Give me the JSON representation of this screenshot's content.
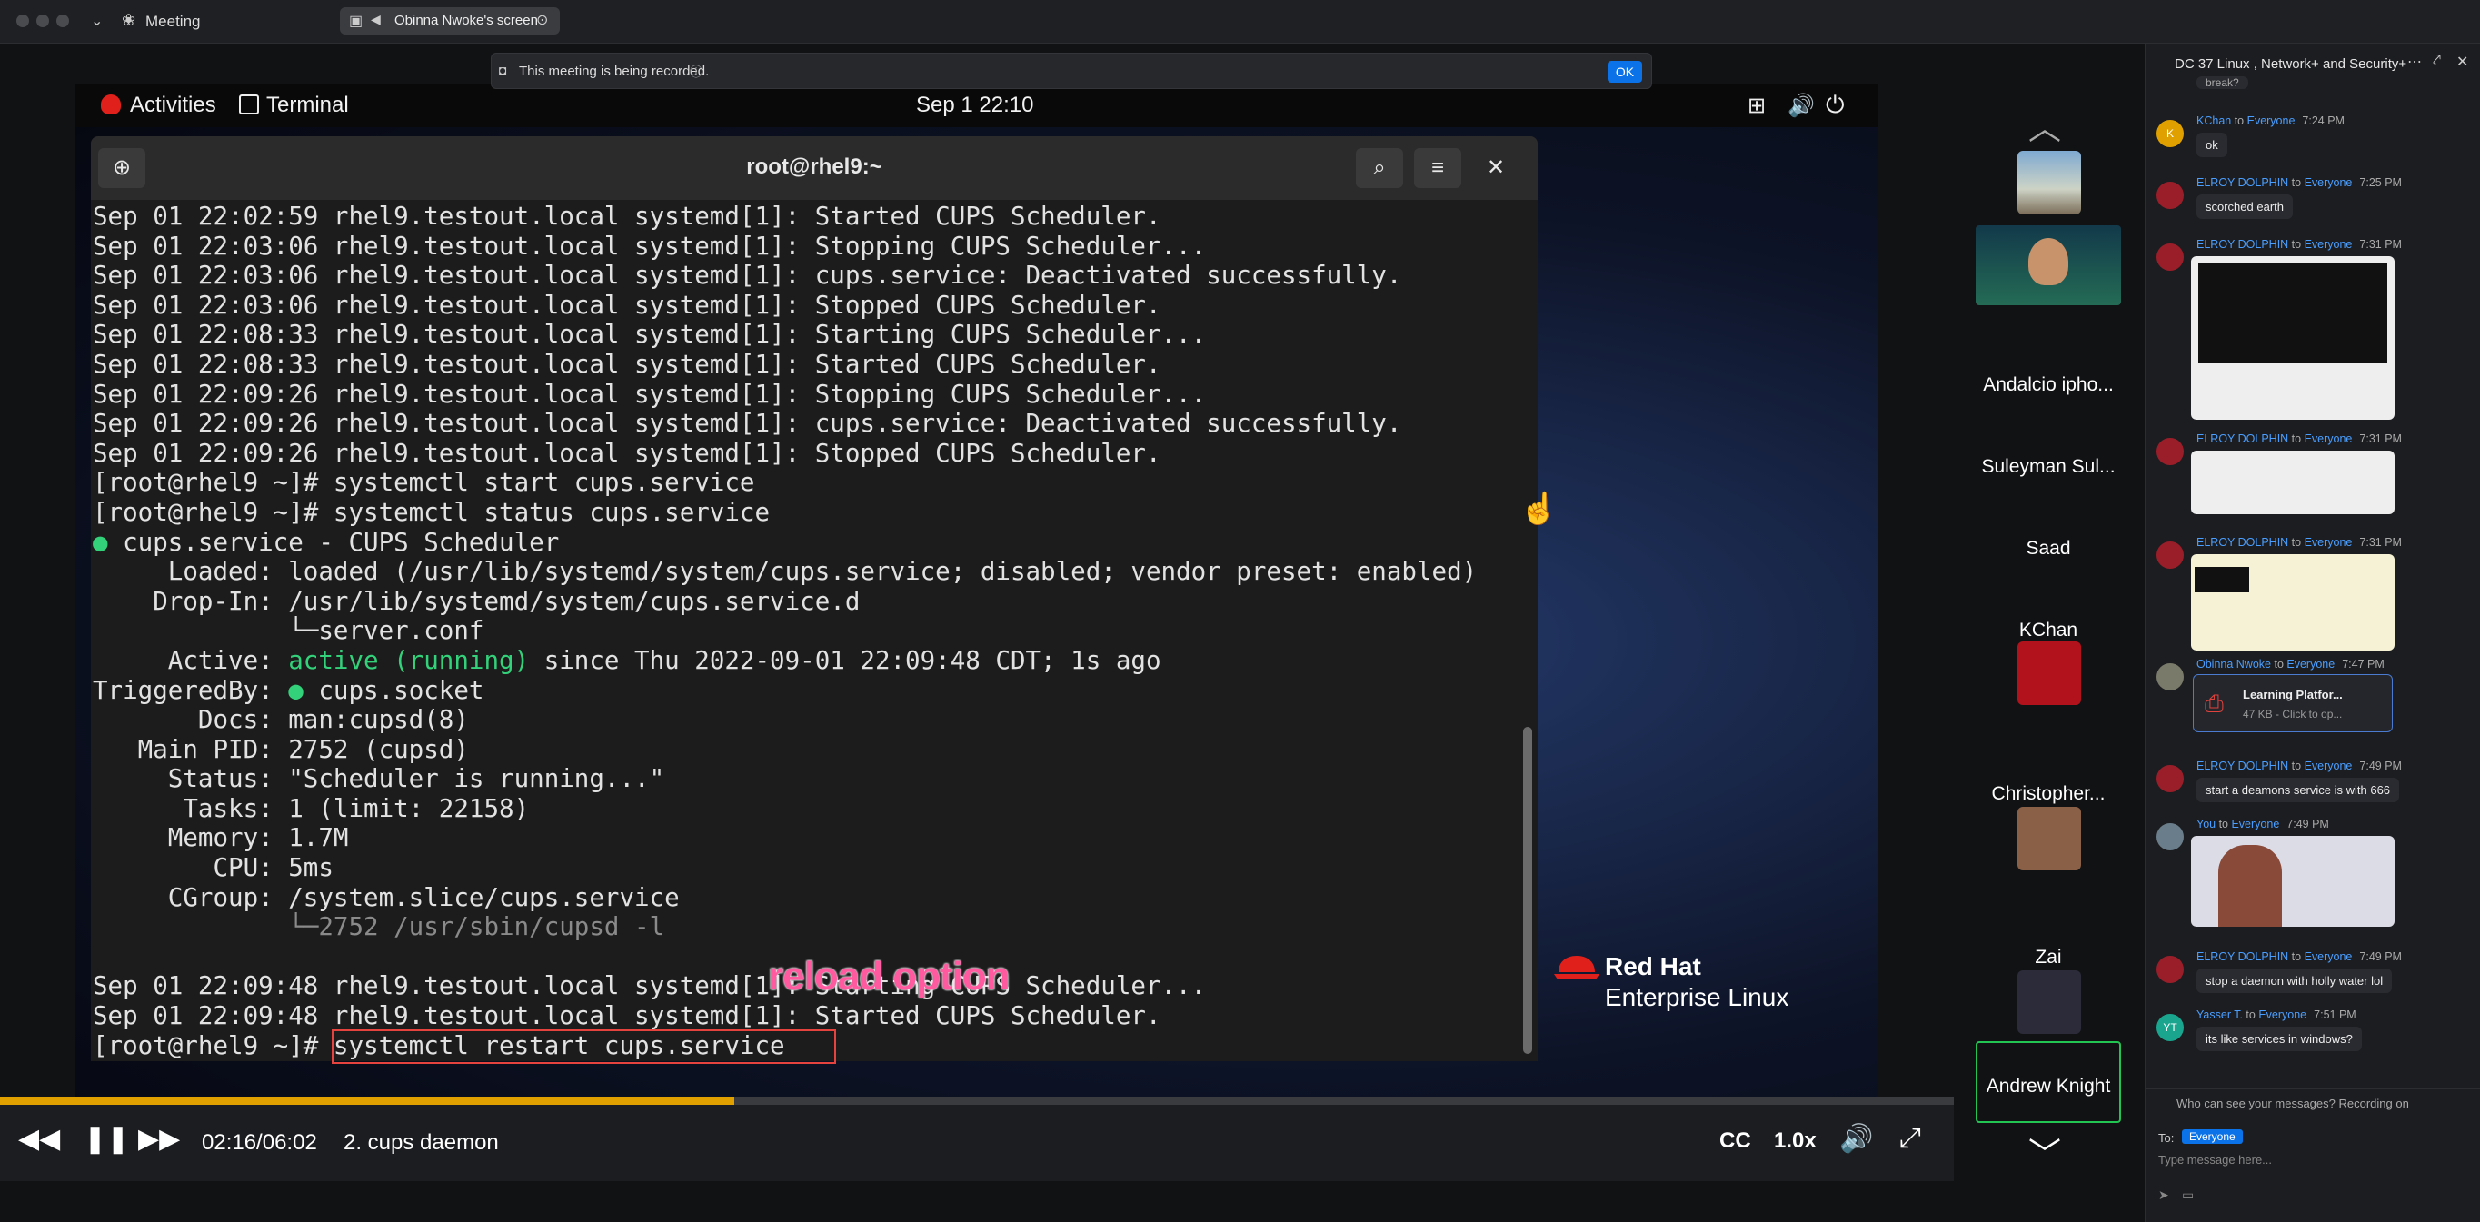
{
  "window": {
    "title": "Meeting",
    "share_pill": "Obinna Nwoke's screen"
  },
  "recording": {
    "text": "This meeting is being recorded.",
    "ok": "OK"
  },
  "desktop": {
    "activities": "Activities",
    "app": "Terminal",
    "clock": "Sep 1  22:10"
  },
  "terminal": {
    "title": "root@rhel9:~",
    "lines": [
      "Sep 01 22:02:59 rhel9.testout.local systemd[1]: Started CUPS Scheduler.",
      "Sep 01 22:03:06 rhel9.testout.local systemd[1]: Stopping CUPS Scheduler...",
      "Sep 01 22:03:06 rhel9.testout.local systemd[1]: cups.service: Deactivated successfully.",
      "Sep 01 22:03:06 rhel9.testout.local systemd[1]: Stopped CUPS Scheduler.",
      "Sep 01 22:08:33 rhel9.testout.local systemd[1]: Starting CUPS Scheduler...",
      "Sep 01 22:08:33 rhel9.testout.local systemd[1]: Started CUPS Scheduler.",
      "Sep 01 22:09:26 rhel9.testout.local systemd[1]: Stopping CUPS Scheduler...",
      "Sep 01 22:09:26 rhel9.testout.local systemd[1]: cups.service: Deactivated successfully.",
      "Sep 01 22:09:26 rhel9.testout.local systemd[1]: Stopped CUPS Scheduler.",
      "[root@rhel9 ~]# systemctl start cups.service",
      "[root@rhel9 ~]# systemctl status cups.service",
      "● cups.service - CUPS Scheduler",
      "     Loaded: loaded (/usr/lib/systemd/system/cups.service; disabled; vendor preset: enabled)",
      "    Drop-In: /usr/lib/systemd/system/cups.service.d",
      "             └─server.conf",
      "     Active: active (running) since Thu 2022-09-01 22:09:48 CDT; 1s ago",
      "TriggeredBy: ● cups.socket",
      "       Docs: man:cupsd(8)",
      "   Main PID: 2752 (cupsd)",
      "     Status: \"Scheduler is running...\"",
      "      Tasks: 1 (limit: 22158)",
      "     Memory: 1.7M",
      "        CPU: 5ms",
      "     CGroup: /system.slice/cups.service",
      "             └─2752 /usr/sbin/cupsd -l",
      "",
      "Sep 01 22:09:48 rhel9.testout.local systemd[1]: Starting CUPS Scheduler...",
      "Sep 01 22:09:48 rhel9.testout.local systemd[1]: Started CUPS Scheduler.",
      "[root@rhel9 ~]# systemctl restart cups.service"
    ]
  },
  "annotation": {
    "reload": "reload option"
  },
  "brand": {
    "line1": "Red Hat",
    "line2": "Enterprise Linux"
  },
  "player": {
    "time": "02:16/06:02",
    "chapter": "2. cups daemon",
    "cc": "CC",
    "speed": "1.0x",
    "progress": 0.376
  },
  "participants": [
    {
      "name": "Andalcio ipho...",
      "kind": "name"
    },
    {
      "name": "Suleyman Sul...",
      "kind": "name"
    },
    {
      "name": "Saad",
      "kind": "name"
    },
    {
      "name": "KChan",
      "kind": "name"
    },
    {
      "name": "Christopher...",
      "kind": "name"
    },
    {
      "name": "Zai",
      "kind": "name"
    },
    {
      "name": "Andrew Knight",
      "kind": "name"
    }
  ],
  "chat": {
    "title": "DC 37 Linux , Network+ and Security+",
    "to_label": "to",
    "everyone": "Everyone",
    "messages": [
      {
        "from": "KChan",
        "time": "7:24 PM",
        "text": "ok",
        "avatar": "K"
      },
      {
        "from": "ELROY DOLPHIN",
        "time": "7:25 PM",
        "text": "scorched earth"
      },
      {
        "from": "ELROY DOLPHIN",
        "time": "7:31 PM",
        "text": ""
      },
      {
        "from": "ELROY DOLPHIN",
        "time": "7:31 PM",
        "text": ""
      },
      {
        "from": "ELROY DOLPHIN",
        "time": "7:31 PM",
        "text": ""
      },
      {
        "from": "Obinna Nwoke",
        "time": "7:47 PM",
        "text": ""
      },
      {
        "from": "ELROY DOLPHIN",
        "time": "7:49 PM",
        "text": "start a deamons service is with 666"
      },
      {
        "from": "You",
        "time": "7:49 PM",
        "text": ""
      },
      {
        "from": "ELROY DOLPHIN",
        "time": "7:49 PM",
        "text": "stop a daemon with holly water lol"
      },
      {
        "from": "Yasser T.",
        "time": "7:51 PM",
        "text": "its like services in windows?",
        "avatar": "YT"
      }
    ],
    "file": {
      "name": "Learning Platfor...",
      "meta": "47 KB - Click to op..."
    },
    "visibility": "Who can see your messages? Recording on",
    "to": "To:",
    "recipient": "Everyone",
    "placeholder": "Type message here...",
    "partial_top": "break?"
  }
}
